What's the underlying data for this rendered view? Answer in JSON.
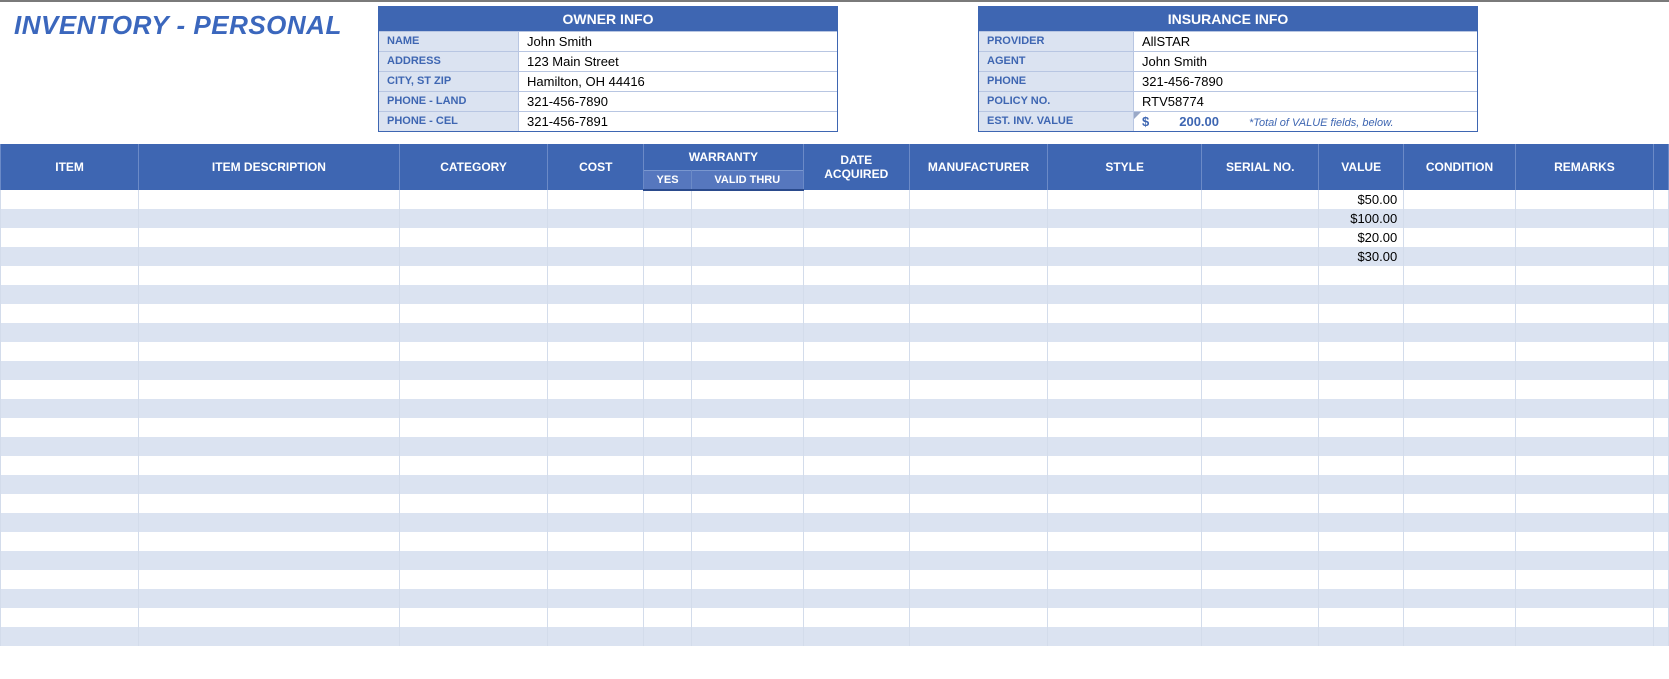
{
  "title": "INVENTORY - PERSONAL",
  "owner_info": {
    "header": "OWNER INFO",
    "name_label": "NAME",
    "name": "John Smith",
    "address_label": "ADDRESS",
    "address": "123 Main Street",
    "city_label": "CITY, ST  ZIP",
    "city": "Hamilton, OH  44416",
    "phone_land_label": "PHONE - LAND",
    "phone_land": "321-456-7890",
    "phone_cel_label": "PHONE - CEL",
    "phone_cel": "321-456-7891"
  },
  "insurance_info": {
    "header": "INSURANCE INFO",
    "provider_label": "PROVIDER",
    "provider": "AllSTAR",
    "agent_label": "AGENT",
    "agent": "John Smith",
    "phone_label": "PHONE",
    "phone": "321-456-7890",
    "policy_label": "POLICY NO.",
    "policy": "RTV58774",
    "est_value_label": "EST. INV. VALUE",
    "est_value_symbol": "$",
    "est_value_amount": "200.00",
    "est_value_note": "*Total of VALUE fields, below."
  },
  "columns": {
    "item": "ITEM",
    "desc": "ITEM DESCRIPTION",
    "category": "CATEGORY",
    "cost": "COST",
    "warranty": "WARRANTY",
    "warranty_yes": "YES",
    "warranty_thru": "VALID THRU",
    "date_acquired": "DATE ACQUIRED",
    "manufacturer": "MANUFACTURER",
    "style": "STYLE",
    "serial": "SERIAL NO.",
    "value": "VALUE",
    "condition": "CONDITION",
    "remarks": "REMARKS"
  },
  "rows": [
    {
      "value": "$50.00"
    },
    {
      "value": "$100.00"
    },
    {
      "value": "$20.00"
    },
    {
      "value": "$30.00"
    },
    {
      "value": ""
    },
    {
      "value": ""
    },
    {
      "value": ""
    },
    {
      "value": ""
    },
    {
      "value": ""
    },
    {
      "value": ""
    },
    {
      "value": ""
    },
    {
      "value": ""
    },
    {
      "value": ""
    },
    {
      "value": ""
    },
    {
      "value": ""
    },
    {
      "value": ""
    },
    {
      "value": ""
    },
    {
      "value": ""
    },
    {
      "value": ""
    },
    {
      "value": ""
    },
    {
      "value": ""
    },
    {
      "value": ""
    },
    {
      "value": ""
    },
    {
      "value": ""
    }
  ]
}
